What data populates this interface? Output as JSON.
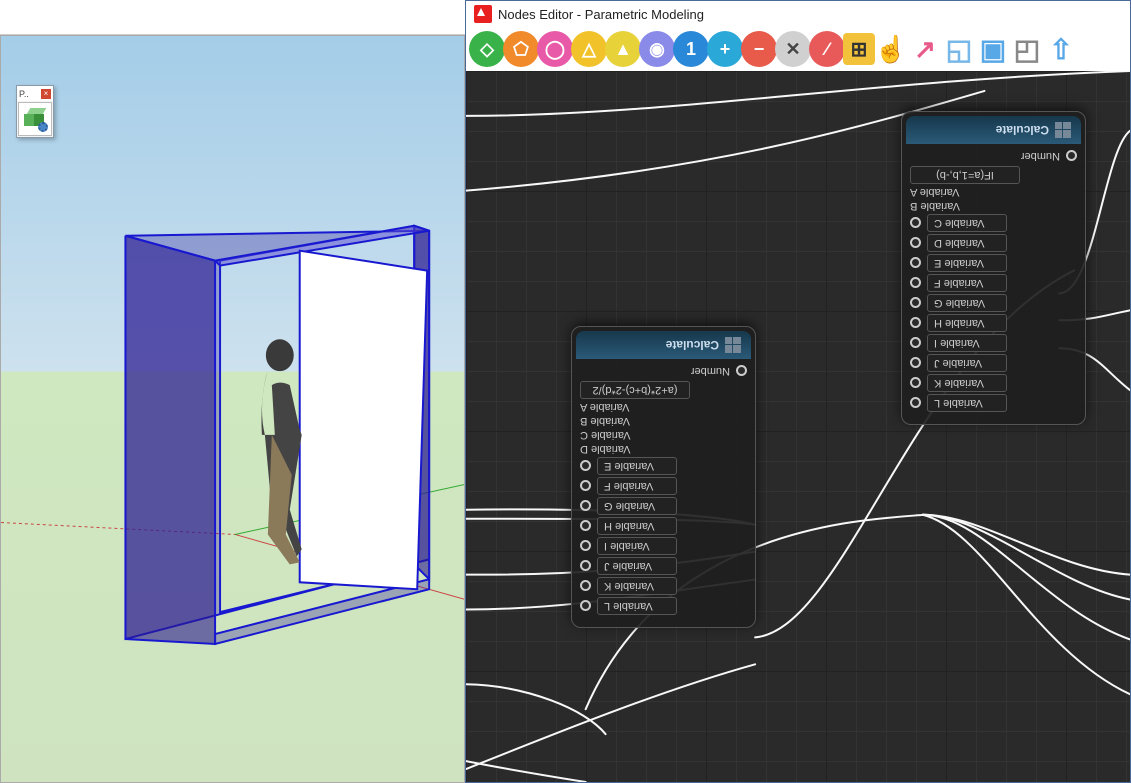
{
  "window": {
    "title": "Nodes Editor - Parametric Modeling"
  },
  "palette": {
    "title": "P.."
  },
  "toolbar_icons": [
    {
      "name": "box-icon",
      "bg": "#3ab24a",
      "glyph": "◇"
    },
    {
      "name": "prism-icon",
      "bg": "#f08a2a",
      "glyph": "⬠"
    },
    {
      "name": "cylinder-icon",
      "bg": "#e85aa8",
      "glyph": "◯"
    },
    {
      "name": "pyramid-icon",
      "bg": "#f2c22a",
      "glyph": "△"
    },
    {
      "name": "cone-icon",
      "bg": "#e8d23a",
      "glyph": "▲"
    },
    {
      "name": "sphere-icon",
      "bg": "#8a8ae8",
      "glyph": "◉"
    },
    {
      "name": "number-node-icon",
      "bg": "#2a88d8",
      "glyph": "1"
    },
    {
      "name": "add-icon",
      "bg": "#2aa8d8",
      "glyph": "+"
    },
    {
      "name": "subtract-icon",
      "bg": "#e85a4a",
      "glyph": "−"
    },
    {
      "name": "multiply-icon",
      "bg": "#d0d0d0",
      "glyph": "✕"
    },
    {
      "name": "divide-icon",
      "bg": "#e85a5a",
      "glyph": "∕"
    },
    {
      "name": "calculate-icon",
      "bg": "#f2c23a",
      "glyph": "⊞"
    },
    {
      "name": "point-icon",
      "bg": "#f0a050",
      "glyph": "☝"
    },
    {
      "name": "vector-icon",
      "bg": "#e85a8a",
      "glyph": "↗"
    },
    {
      "name": "intersect-icon",
      "bg": "#78b8e8",
      "glyph": "◱"
    },
    {
      "name": "union-icon",
      "bg": "#58a8e8",
      "glyph": "▣"
    },
    {
      "name": "subtract-solid-icon",
      "bg": "#888",
      "glyph": "◰"
    },
    {
      "name": "push-icon",
      "bg": "#58a8e8",
      "glyph": "⇧"
    }
  ],
  "node1": {
    "title": "Calculate",
    "output_label": "Number",
    "formula": "(a+2*(b+c)-2*d)/2",
    "variables_with_port": [
      "Variable E",
      "Variable F",
      "Variable G",
      "Variable H",
      "Variable I",
      "Variable J",
      "Variable K",
      "Variable L"
    ],
    "variables_plain": [
      "Variable A",
      "Variable B",
      "Variable C",
      "Variable D"
    ]
  },
  "node2": {
    "title": "Calculate",
    "output_label": "Number",
    "formula": "IF(a=1,b,-b)",
    "variables_with_port": [
      "Variable C",
      "Variable D",
      "Variable E",
      "Variable F",
      "Variable G",
      "Variable H",
      "Variable I",
      "Variable J",
      "Variable K",
      "Variable L"
    ],
    "variables_plain": [
      "Variable A",
      "Variable B"
    ]
  }
}
